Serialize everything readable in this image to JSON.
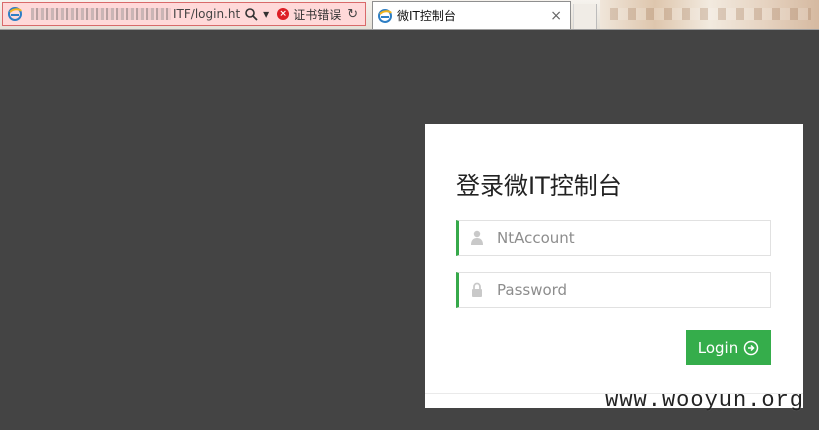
{
  "browser": {
    "address": {
      "url_suffix": "ITF/login.ht",
      "certificate_error": "证书错误"
    },
    "tab": {
      "title": "微IT控制台",
      "close_label": "×"
    }
  },
  "login": {
    "title": "登录微IT控制台",
    "account_placeholder": "NtAccount",
    "password_placeholder": "Password",
    "button_label": "Login"
  },
  "watermark": "www.wooyun.org",
  "colors": {
    "page_background": "#444444",
    "card_background": "#ffffff",
    "accent_green": "#35ad4b",
    "error_red": "#dd1f26"
  },
  "icons": {
    "browser": "ie-icon",
    "search": "search-icon",
    "certificate": "certificate-error-icon",
    "refresh": "refresh-icon",
    "user": "user-icon",
    "lock": "lock-icon",
    "login": "arrow-right-circle-icon"
  }
}
